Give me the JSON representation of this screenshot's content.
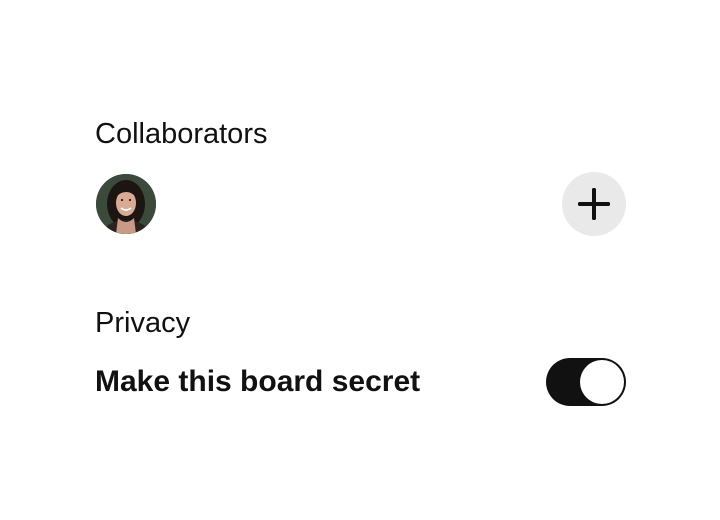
{
  "collaborators": {
    "title": "Collaborators",
    "avatar_icon": "person-portrait-avatar",
    "add_icon": "plus-icon"
  },
  "privacy": {
    "title": "Privacy",
    "secret_label": "Make this board secret",
    "secret_enabled": true
  },
  "colors": {
    "toggle_on": "#111111",
    "add_button_bg": "#e9e9e9",
    "text": "#111111"
  }
}
